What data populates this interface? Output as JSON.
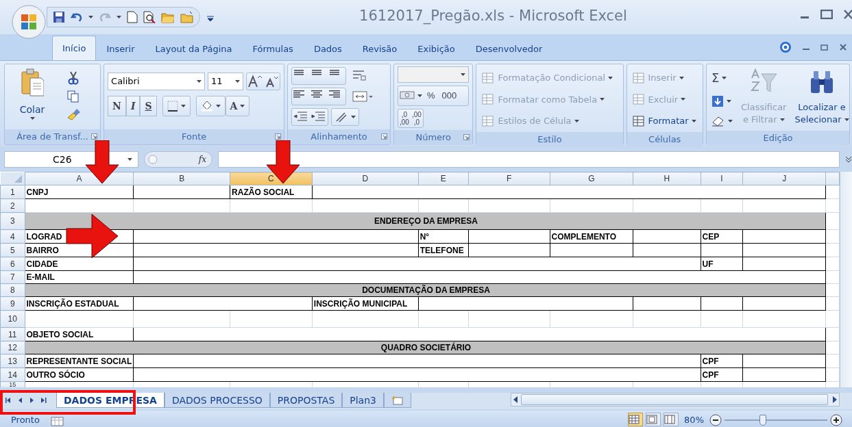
{
  "window": {
    "title": "1612017_Pregão.xls - Microsoft Excel"
  },
  "ribbon_tabs": [
    {
      "label": "Início",
      "selected": true
    },
    {
      "label": "Inserir",
      "selected": false
    },
    {
      "label": "Layout da Página",
      "selected": false
    },
    {
      "label": "Fórmulas",
      "selected": false
    },
    {
      "label": "Dados",
      "selected": false
    },
    {
      "label": "Revisão",
      "selected": false
    },
    {
      "label": "Exibição",
      "selected": false
    },
    {
      "label": "Desenvolvedor",
      "selected": false
    }
  ],
  "ribbon_groups": [
    {
      "kind": "clipboard",
      "label": "Área de Transf...",
      "paste": "Colar"
    },
    {
      "kind": "font",
      "label": "Fonte",
      "font_name": "Calibri",
      "font_size": "11",
      "style_buttons": [
        "N",
        "I",
        "S"
      ],
      "font_color": "A"
    },
    {
      "kind": "alignment",
      "label": "Alinhamento"
    },
    {
      "kind": "number",
      "label": "Número",
      "buttons": [
        "%",
        "000"
      ],
      "decimal_buttons": [
        {
          "top": ",0",
          "bottom": ",00"
        },
        {
          "top": ",00",
          "bottom": ",0"
        }
      ]
    },
    {
      "kind": "styles",
      "label": "Estilo",
      "items": [
        {
          "label": "Formatação Condicional",
          "disabled": true
        },
        {
          "label": "Formatar como Tabela",
          "disabled": true
        },
        {
          "label": "Estilos de Célula",
          "disabled": true
        }
      ]
    },
    {
      "kind": "cells",
      "label": "Células",
      "items": [
        {
          "label": "Inserir",
          "disabled": true
        },
        {
          "label": "Excluir",
          "disabled": true
        },
        {
          "label": "Formatar",
          "disabled": false
        }
      ]
    },
    {
      "kind": "editing",
      "label": "Edição",
      "sum": "Σ",
      "big_buttons": [
        {
          "lines": [
            "Classificar",
            "e Filtrar"
          ],
          "disabled": true
        },
        {
          "lines": [
            "Localizar e",
            "Selecionar"
          ],
          "disabled": false
        }
      ]
    }
  ],
  "name_box": "C26",
  "formula_label": "fx",
  "sheet": {
    "columns": [
      {
        "label": "A",
        "selected": false
      },
      {
        "label": "B",
        "selected": false
      },
      {
        "label": "C",
        "selected": true
      },
      {
        "label": "D",
        "selected": false
      },
      {
        "label": "E",
        "selected": false
      },
      {
        "label": "F",
        "selected": false
      },
      {
        "label": "G",
        "selected": false
      },
      {
        "label": "H",
        "selected": false
      },
      {
        "label": "I",
        "selected": false
      },
      {
        "label": "J",
        "selected": false
      }
    ],
    "rows": [
      {
        "number": "1",
        "cells": [
          {
            "text": "CNPJ"
          },
          {},
          {
            "text": "RAZÃO SOCIAL"
          },
          {},
          {
            "merged": true
          },
          {
            "merged": true
          },
          {
            "merged": true
          },
          {
            "merged": true
          },
          {
            "merged": true
          },
          {
            "merged": true
          }
        ]
      },
      {
        "number": "2",
        "cells": []
      },
      {
        "number": "3",
        "cells": [
          {
            "text": "ENDEREÇO DA EMPRESA",
            "kind": "section"
          },
          {
            "merged": true
          },
          {
            "merged": true
          },
          {
            "merged": true
          },
          {
            "merged": true
          },
          {
            "merged": true
          },
          {
            "merged": true
          },
          {
            "merged": true
          },
          {
            "merged": true
          },
          {
            "merged": true
          }
        ]
      },
      {
        "number": "4",
        "cells": [
          {
            "text": "LOGRAD"
          },
          {},
          {
            "merged": true
          },
          {
            "merged": true
          },
          {
            "text": "N°"
          },
          {},
          {
            "text": "COMPLEMENTO"
          },
          {},
          {
            "text": "CEP"
          },
          {}
        ]
      },
      {
        "number": "5",
        "cells": [
          {
            "text": "BAIRRO"
          },
          {},
          {
            "merged": true
          },
          {
            "merged": true
          },
          {
            "text": "TELEFONE"
          },
          {},
          {},
          {},
          {},
          {}
        ]
      },
      {
        "number": "6",
        "cells": [
          {
            "text": "CIDADE"
          },
          {},
          {
            "merged": true
          },
          {
            "merged": true
          },
          {
            "merged": true
          },
          {
            "merged": true
          },
          {
            "merged": true
          },
          {
            "merged": true
          },
          {
            "text": "UF"
          },
          {}
        ]
      },
      {
        "number": "7",
        "cells": [
          {
            "text": "E-MAIL"
          },
          {},
          {
            "merged": true
          },
          {
            "merged": true
          },
          {
            "merged": true
          },
          {
            "merged": true
          },
          {
            "merged": true
          },
          {
            "merged": true
          },
          {
            "merged": true
          },
          {
            "merged": true
          }
        ]
      },
      {
        "number": "8",
        "cells": [
          {
            "text": "DOCUMENTAÇÃO DA EMPRESA",
            "kind": "section"
          },
          {
            "merged": true
          },
          {
            "merged": true
          },
          {
            "merged": true
          },
          {
            "merged": true
          },
          {
            "merged": true
          },
          {
            "merged": true
          },
          {
            "merged": true
          },
          {
            "merged": true
          },
          {
            "merged": true
          }
        ]
      },
      {
        "number": "9",
        "cells": [
          {
            "text": "INSCRIÇÃO ESTADUAL"
          },
          {},
          {
            "merged": true
          },
          {
            "text": "INSCRIÇÃO MUNICIPAL"
          },
          {},
          {
            "merged": true
          },
          {
            "merged": true
          },
          {},
          {},
          {}
        ]
      },
      {
        "number": "10",
        "cells": []
      },
      {
        "number": "11",
        "cells": [
          {
            "text": "OBJETO SOCIAL"
          },
          {},
          {
            "merged": true
          },
          {
            "merged": true
          },
          {
            "merged": true
          },
          {
            "merged": true
          },
          {
            "merged": true
          },
          {
            "merged": true
          },
          {
            "merged": true
          },
          {
            "merged": true
          }
        ]
      },
      {
        "number": "12",
        "cells": [
          {
            "text": "QUADRO SOCIETÁRIO",
            "kind": "section"
          },
          {
            "merged": true
          },
          {
            "merged": true
          },
          {
            "merged": true
          },
          {
            "merged": true
          },
          {
            "merged": true
          },
          {
            "merged": true
          },
          {
            "merged": true
          },
          {
            "merged": true
          },
          {
            "merged": true
          }
        ]
      },
      {
        "number": "13",
        "cells": [
          {
            "text": "REPRESENTANTE SOCIAL"
          },
          {},
          {
            "merged": true
          },
          {
            "merged": true
          },
          {
            "merged": true
          },
          {
            "merged": true
          },
          {
            "merged": true
          },
          {
            "merged": true
          },
          {
            "text": "CPF"
          },
          {}
        ]
      },
      {
        "number": "14",
        "cells": [
          {
            "text": "OUTRO SÓCIO"
          },
          {},
          {
            "merged": true
          },
          {
            "merged": true
          },
          {
            "merged": true
          },
          {
            "merged": true
          },
          {
            "merged": true
          },
          {
            "merged": true
          },
          {
            "text": "CPF"
          },
          {}
        ]
      },
      {
        "number": "15",
        "cells": []
      }
    ]
  },
  "sheet_tabs": [
    {
      "label": "DADOS EMPRESA",
      "selected": true
    },
    {
      "label": "DADOS PROCESSO",
      "selected": false
    },
    {
      "label": "PROPOSTAS",
      "selected": false
    },
    {
      "label": "Plan3",
      "selected": false
    }
  ],
  "status_bar": {
    "text": "Pronto",
    "views": [
      {
        "selected": true
      },
      {
        "selected": false
      },
      {
        "selected": false
      }
    ],
    "zoom": "80%",
    "zoom_level": {
      "level": 0.37
    }
  },
  "annotations": [
    {
      "kind": "arrow-down"
    },
    {
      "kind": "arrow-down"
    },
    {
      "kind": "arrow-right"
    },
    {
      "kind": "frame"
    }
  ]
}
